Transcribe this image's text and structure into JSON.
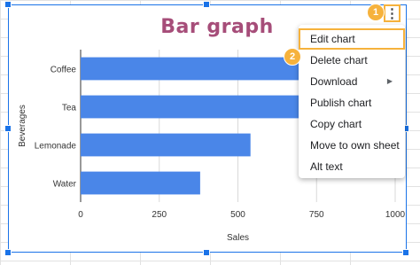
{
  "menu": {
    "items": [
      {
        "label": "Edit chart"
      },
      {
        "label": "Delete chart"
      },
      {
        "label": "Download"
      },
      {
        "label": "Publish chart"
      },
      {
        "label": "Copy chart"
      },
      {
        "label": "Move to own sheet"
      },
      {
        "label": "Alt text"
      }
    ],
    "more_icon": "⋮"
  },
  "badges": [
    "1",
    "2"
  ],
  "colors": {
    "bar": "#4a86e8",
    "title": "#a64d79",
    "accent": "#f6b23c",
    "selection": "#1a73e8"
  },
  "chart_data": {
    "type": "bar",
    "orientation": "horizontal",
    "title": "Bar graph",
    "xlabel": "Sales",
    "ylabel": "Beverages",
    "categories": [
      "Coffee",
      "Tea",
      "Lemonade",
      "Water"
    ],
    "values": [
      750,
      820,
      540,
      380
    ],
    "xlim": [
      0,
      1000
    ],
    "xticks": [
      "0",
      "250",
      "500",
      "750",
      "1000"
    ],
    "grid": true
  }
}
